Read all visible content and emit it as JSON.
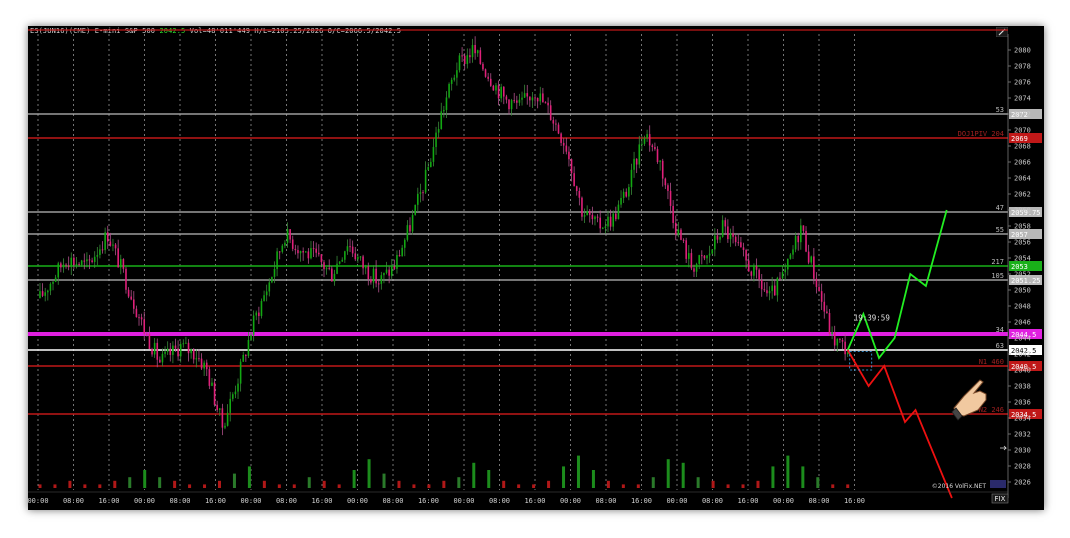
{
  "header": {
    "symbol": "ES(JUN16)(CME) E-mini S&P 500",
    "last": "2042.5",
    "stats": "Vol=48'011'449 H/L=2105.25/2026 O/C=2066.5/2042.5"
  },
  "watermark": "©2016 VolFix.NET",
  "fix_label": "FIX",
  "timer": "19:39:59",
  "colors": {
    "up": "#12a812",
    "down": "#e0207a",
    "white_level": "#b8b8b8",
    "green_level": "#19b019",
    "red_level": "#c01818",
    "magenta_level": "#e020e0",
    "projection_up": "#22ee22",
    "projection_down": "#ee1010"
  },
  "chart_data": {
    "type": "candlestick",
    "ylim": [
      2025,
      2082
    ],
    "y_ticks": [
      "2026",
      "2028",
      "2030",
      "2032",
      "2034",
      "2036",
      "2038",
      "2040",
      "2042",
      "2044",
      "2046",
      "2048",
      "2050",
      "2052",
      "2054",
      "2056",
      "2058",
      "2060",
      "2062",
      "2064",
      "2066",
      "2068",
      "2070",
      "2072",
      "2074",
      "2076",
      "2078",
      "2080"
    ],
    "x_ticks": [
      "00:00",
      "08:00",
      "16:00",
      "00:00",
      "08:00",
      "16:00",
      "00:00",
      "08:00",
      "16:00",
      "00:00",
      "08:00",
      "16:00",
      "00:00",
      "08:00",
      "16:00",
      "00:00",
      "08:00",
      "16:00",
      "00:00",
      "08:00",
      "16:00",
      "00:00",
      "08:00",
      "16:00"
    ],
    "price_path": [
      [
        0,
        2049
      ],
      [
        5,
        2054
      ],
      [
        9,
        2053
      ],
      [
        13,
        2057
      ],
      [
        16,
        2052
      ],
      [
        20,
        2045
      ],
      [
        23,
        2041
      ],
      [
        27,
        2043
      ],
      [
        30,
        2042
      ],
      [
        32,
        2040
      ],
      [
        35,
        2033
      ],
      [
        38,
        2039
      ],
      [
        41,
        2046
      ],
      [
        44,
        2051
      ],
      [
        47,
        2057
      ],
      [
        50,
        2055
      ],
      [
        53,
        2054
      ],
      [
        56,
        2052
      ],
      [
        59,
        2056
      ],
      [
        62,
        2053
      ],
      [
        65,
        2051
      ],
      [
        68,
        2053
      ],
      [
        71,
        2058
      ],
      [
        74,
        2064
      ],
      [
        77,
        2072
      ],
      [
        80,
        2078
      ],
      [
        83,
        2080
      ],
      [
        86,
        2077
      ],
      [
        89,
        2074
      ],
      [
        92,
        2073
      ],
      [
        95,
        2075
      ],
      [
        98,
        2072
      ],
      [
        101,
        2068
      ],
      [
        104,
        2060
      ],
      [
        107,
        2058
      ],
      [
        110,
        2059
      ],
      [
        113,
        2063
      ],
      [
        116,
        2070
      ],
      [
        119,
        2066
      ],
      [
        122,
        2058
      ],
      [
        125,
        2053
      ],
      [
        128,
        2054
      ],
      [
        131,
        2058
      ],
      [
        134,
        2055
      ],
      [
        137,
        2052
      ],
      [
        140,
        2049
      ],
      [
        143,
        2052
      ],
      [
        146,
        2058
      ],
      [
        149,
        2051
      ],
      [
        152,
        2044
      ],
      [
        155,
        2042.5
      ]
    ],
    "volume": [
      1,
      1,
      2,
      1,
      1,
      2,
      3,
      5,
      3,
      2,
      1,
      1,
      2,
      4,
      6,
      2,
      1,
      1,
      3,
      2,
      1,
      5,
      8,
      4,
      2,
      1,
      1,
      2,
      3,
      7,
      5,
      2,
      1,
      1,
      2,
      6,
      9,
      5,
      2,
      1,
      1,
      3,
      8,
      7,
      3,
      2,
      1,
      1,
      2,
      6,
      9,
      6,
      3,
      1,
      1
    ],
    "levels": [
      {
        "price": 2072,
        "label": "53",
        "price_text": "2072",
        "kind": "white"
      },
      {
        "price": 2069,
        "label": "DOJ1PIV 204",
        "price_text": "2069",
        "kind": "red"
      },
      {
        "price": 2059.75,
        "label": "47",
        "price_text": "2059.75",
        "kind": "white"
      },
      {
        "price": 2057,
        "label": "55",
        "price_text": "2057",
        "kind": "white"
      },
      {
        "price": 2053,
        "label": "217",
        "price_text": "2053",
        "kind": "green"
      },
      {
        "price": 2051.25,
        "label": "105",
        "price_text": "2051.25",
        "kind": "white"
      },
      {
        "price": 2044.5,
        "label": "34",
        "price_text": "2044.5",
        "kind": "magenta"
      },
      {
        "price": 2042.5,
        "label": "63",
        "price_text": "2042.5",
        "kind": "current"
      },
      {
        "price": 2040.5,
        "label": "N1 460",
        "price_text": "2040.5",
        "kind": "red"
      },
      {
        "price": 2034.5,
        "label": "N2 246",
        "price_text": "2034.5",
        "kind": "red"
      }
    ],
    "projection_up": [
      [
        155,
        2042.5
      ],
      [
        158,
        2047
      ],
      [
        161,
        2041.5
      ],
      [
        164,
        2044
      ],
      [
        167,
        2052
      ],
      [
        170,
        2050.5
      ],
      [
        174,
        2060
      ]
    ],
    "projection_down": [
      [
        155,
        2042.5
      ],
      [
        159,
        2038
      ],
      [
        162,
        2040.5
      ],
      [
        166,
        2033.5
      ],
      [
        168,
        2035
      ],
      [
        175,
        2024
      ]
    ]
  }
}
